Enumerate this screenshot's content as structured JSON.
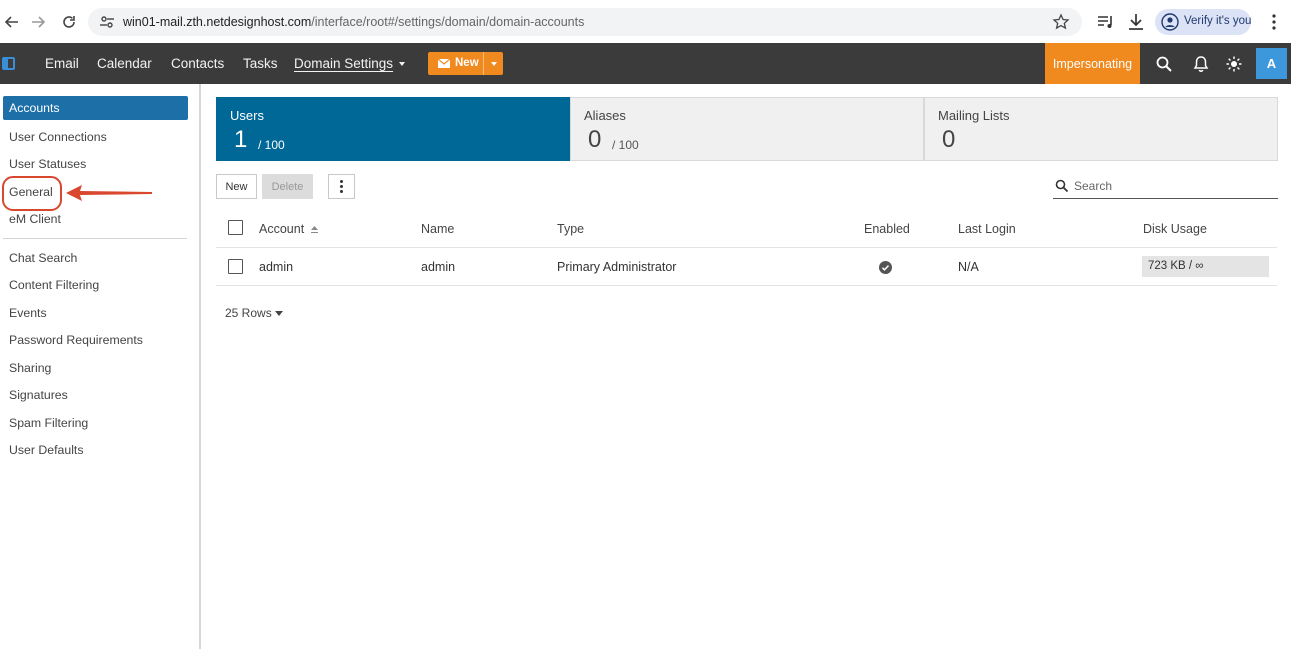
{
  "browser": {
    "url_host": "win01-mail.zth.netdesignhost.com",
    "url_path": "/interface/root#/settings/domain/domain-accounts",
    "profile_label": "Verify it's you",
    "icons": [
      "back-icon",
      "forward-icon",
      "reload-icon",
      "site-settings-icon",
      "bookmark-star-icon",
      "media-controls-icon",
      "download-icon",
      "more-vert-icon"
    ]
  },
  "app_nav": {
    "items": [
      "Email",
      "Calendar",
      "Contacts",
      "Tasks"
    ],
    "active_item": "Domain Settings",
    "new_label": "New",
    "impersonating_label": "Impersonating",
    "avatar_letter": "A",
    "accent_color": "#f0891e",
    "brand_color": "#006897"
  },
  "sidebar": {
    "items_group1": [
      "Accounts",
      "User Connections",
      "User Statuses",
      "General",
      "eM Client"
    ],
    "items_group2": [
      "Chat Search",
      "Content Filtering",
      "Events",
      "Password Requirements",
      "Sharing",
      "Signatures",
      "Spam Filtering",
      "User Defaults"
    ],
    "active_item": "Accounts"
  },
  "stats": [
    {
      "label": "Users",
      "value": "1",
      "max": "/ 100"
    },
    {
      "label": "Aliases",
      "value": "0",
      "max": "/ 100"
    },
    {
      "label": "Mailing Lists",
      "value": "0",
      "max": ""
    }
  ],
  "toolbar": {
    "new_label": "New",
    "delete_label": "Delete",
    "search_placeholder": "Search"
  },
  "table": {
    "columns": [
      "Account",
      "Name",
      "Type",
      "Enabled",
      "Last Login",
      "Disk Usage"
    ],
    "rows": [
      {
        "account": "admin",
        "name": "admin",
        "type": "Primary Administrator",
        "enabled": true,
        "last_login": "N/A",
        "disk_usage": "723 KB / ∞"
      }
    ],
    "rows_per_page": "25 Rows"
  }
}
